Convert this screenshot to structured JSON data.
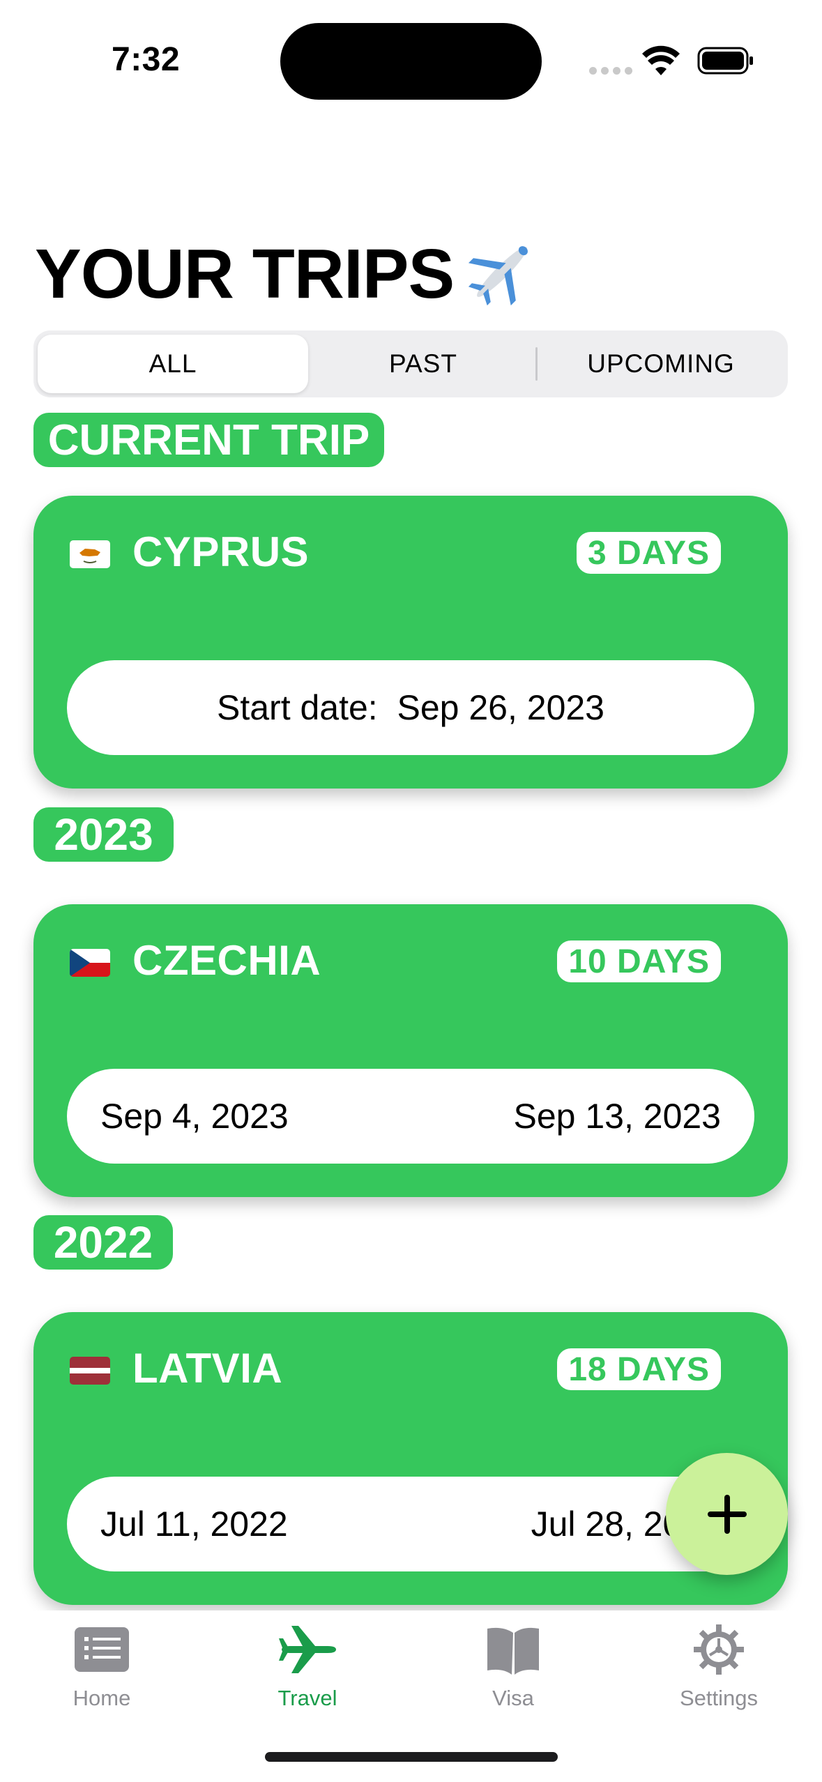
{
  "status_bar": {
    "time": "7:32"
  },
  "header": {
    "title": "YOUR TRIPS"
  },
  "filter": {
    "segments": [
      "ALL",
      "PAST",
      "UPCOMING"
    ],
    "selected": "ALL"
  },
  "sections": {
    "current_label": "CURRENT TRIP",
    "year_2023": "2023",
    "year_2022": "2022"
  },
  "trips": [
    {
      "country": "CYPRUS",
      "flag": "cyprus-flag-icon",
      "days": "3 DAYS",
      "start_label": "Start date:",
      "start": "Sep 26, 2023"
    },
    {
      "country": "CZECHIA",
      "flag": "czechia-flag-icon",
      "days": "10 DAYS",
      "start": "Sep 4, 2023",
      "end": "Sep 13, 2023"
    },
    {
      "country": "LATVIA",
      "flag": "latvia-flag-icon",
      "days": "18 DAYS",
      "start": "Jul 11, 2022",
      "end": "Jul 28, 2022"
    }
  ],
  "fab": {
    "icon": "plus-icon"
  },
  "tabbar": {
    "items": [
      {
        "label": "Home",
        "icon": "list-icon"
      },
      {
        "label": "Travel",
        "icon": "airplane-icon"
      },
      {
        "label": "Visa",
        "icon": "book-icon"
      },
      {
        "label": "Settings",
        "icon": "gear-icon"
      }
    ],
    "active": "Travel"
  },
  "colors": {
    "accent_green": "#36c75c",
    "fab": "#cbf19a",
    "tab_active": "#1a9c4a",
    "tab_inactive": "#8e8e93"
  }
}
